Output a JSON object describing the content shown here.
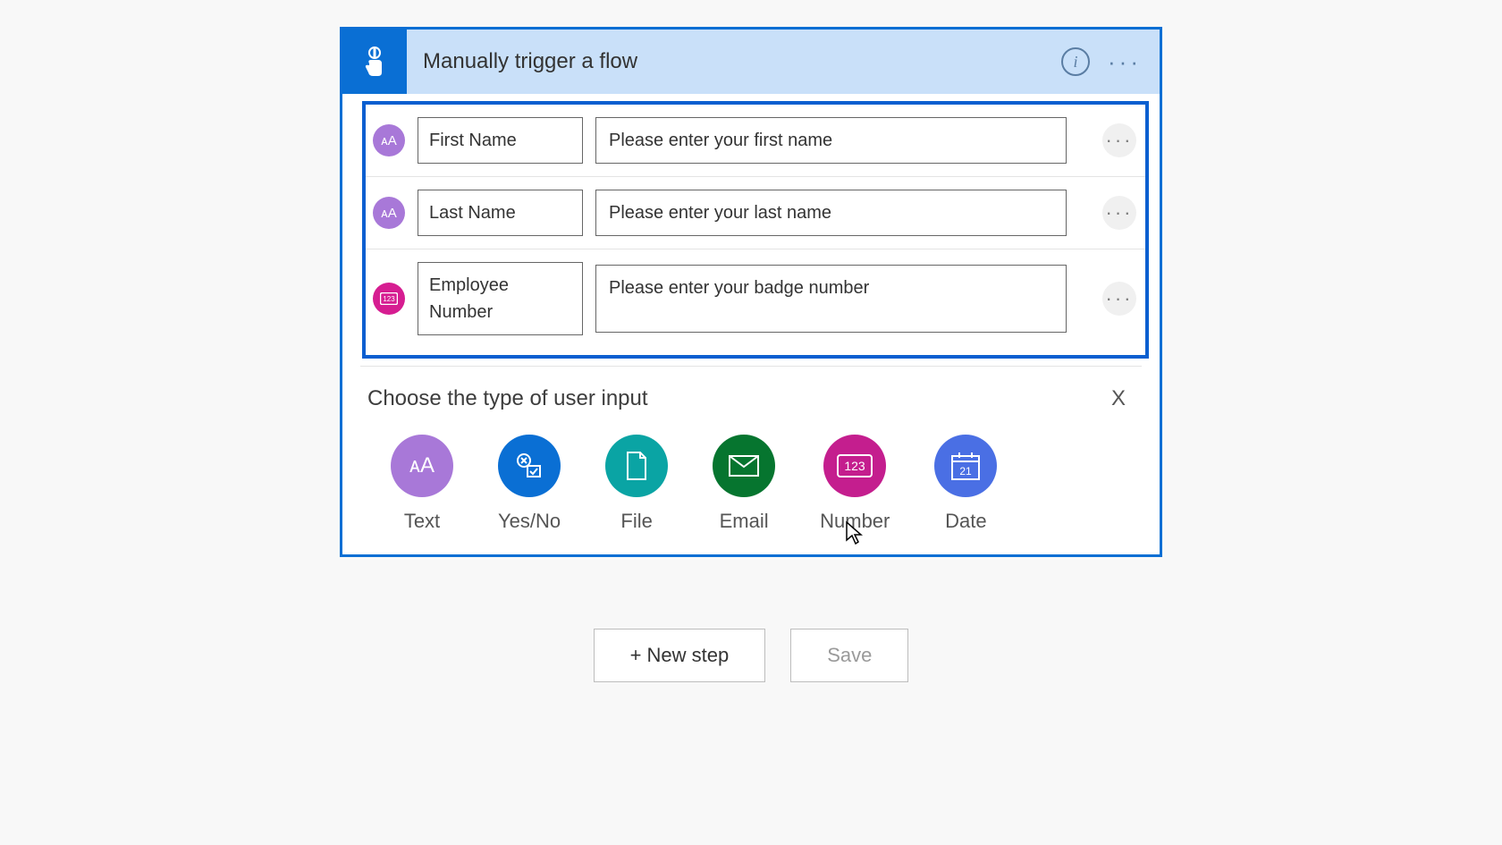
{
  "header": {
    "title": "Manually trigger a flow"
  },
  "inputs": [
    {
      "type": "text",
      "name": "First Name",
      "prompt": "Please enter your first name"
    },
    {
      "type": "text",
      "name": "Last Name",
      "prompt": "Please enter your last name"
    },
    {
      "type": "number",
      "name": "Employee Number",
      "prompt": "Please enter your badge number"
    }
  ],
  "picker": {
    "title": "Choose the type of user input",
    "close": "X",
    "options": [
      {
        "key": "text",
        "label": "Text"
      },
      {
        "key": "yesno",
        "label": "Yes/No"
      },
      {
        "key": "file",
        "label": "File"
      },
      {
        "key": "email",
        "label": "Email"
      },
      {
        "key": "number",
        "label": "Number"
      },
      {
        "key": "date",
        "label": "Date"
      }
    ]
  },
  "footer": {
    "new_step": "+ New step",
    "save": "Save"
  }
}
